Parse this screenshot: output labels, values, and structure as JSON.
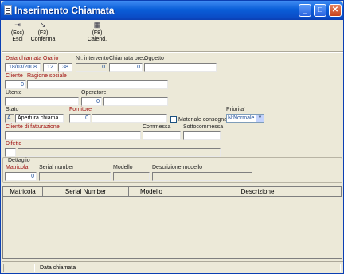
{
  "window": {
    "title": "Inserimento Chiamata"
  },
  "toolbar": [
    {
      "shortcut": "(Esc)",
      "label": "Esci",
      "icon": "exit-icon"
    },
    {
      "shortcut": "(F3)",
      "label": "Conferma",
      "icon": "confirm-icon"
    },
    {
      "shortcut": "(F8)",
      "label": "Calend.",
      "icon": "calendar-icon"
    }
  ],
  "form": {
    "data_chiamata": {
      "label": "Data chiamata",
      "value": "18/03/2008"
    },
    "orario": {
      "label": "Orario",
      "hour": "12",
      "minute": "38"
    },
    "nr_intervento": {
      "label": "Nr. intervento",
      "value": "0"
    },
    "chiamata_prec": {
      "label": "Chiamata prec.",
      "value": "0"
    },
    "oggetto": {
      "label": "Oggetto",
      "value": ""
    },
    "cliente": {
      "label": "Cliente",
      "value": "0"
    },
    "ragione_sociale": {
      "label": "Ragione sociale",
      "value": ""
    },
    "utente": {
      "label": "Utente",
      "value": ""
    },
    "operatore": {
      "label": "Operatore",
      "code": "0",
      "value": ""
    },
    "stato": {
      "label": "Stato",
      "code": "A",
      "value": "Apertura chiama"
    },
    "fornitore": {
      "label": "Fornitore",
      "code": "0",
      "value": ""
    },
    "materiale_consegnato": {
      "label": "Materiale consegnato",
      "checked": false
    },
    "priorita": {
      "label": "Priorita'",
      "value": "N:Normale"
    },
    "cliente_fatturazione": {
      "label": "Cliente di fatturazione",
      "value": ""
    },
    "commessa": {
      "label": "Commessa",
      "value": ""
    },
    "sottocommessa": {
      "label": "Sottocommessa",
      "value": ""
    },
    "difetto": {
      "label": "Difetto",
      "code": "",
      "value": ""
    }
  },
  "dettaglio": {
    "title": "Dettaglio",
    "matricola": {
      "label": "Matricola",
      "value": "0"
    },
    "serial_number": {
      "label": "Serial number",
      "value": ""
    },
    "modello": {
      "label": "Modello",
      "value": ""
    },
    "descrizione_modello": {
      "label": "Descrizione modello",
      "value": ""
    }
  },
  "grid": {
    "columns": [
      "Matricola",
      "Serial Number",
      "Modello",
      "Descrizione"
    ],
    "rows": []
  },
  "statusbar": {
    "text": "Data chiamata"
  },
  "colors": {
    "titlebar": "#0a5ed8",
    "label_red": "#a01010",
    "value_blue": "#1d4e9a",
    "window_bg": "#ece9d8"
  }
}
